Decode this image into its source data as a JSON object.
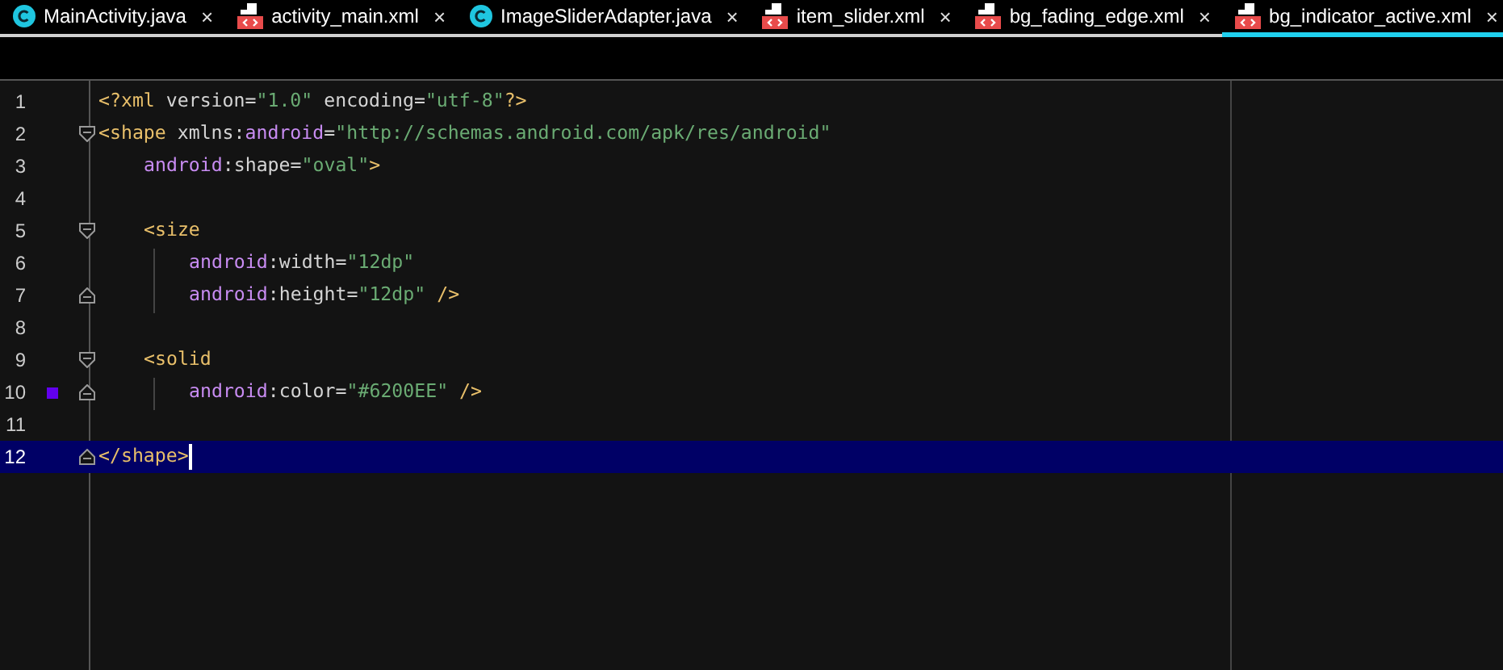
{
  "tabs": [
    {
      "label": "MainActivity.java",
      "kind": "class",
      "selected": false
    },
    {
      "label": "activity_main.xml",
      "kind": "xml",
      "selected": false
    },
    {
      "label": "ImageSliderAdapter.java",
      "kind": "class",
      "selected": false
    },
    {
      "label": "item_slider.xml",
      "kind": "xml",
      "selected": false
    },
    {
      "label": "bg_fading_edge.xml",
      "kind": "xml",
      "selected": false
    },
    {
      "label": "bg_indicator_active.xml",
      "kind": "xml",
      "selected": true
    }
  ],
  "close_glyph": "×",
  "lines": [
    {
      "number": "1",
      "tokens": [
        {
          "kind": "tag",
          "text": "<?xml"
        },
        {
          "kind": "plain",
          "text": " version="
        },
        {
          "kind": "str",
          "text": "\"1.0\""
        },
        {
          "kind": "plain",
          "text": " encoding="
        },
        {
          "kind": "str",
          "text": "\"utf-8\""
        },
        {
          "kind": "tag",
          "text": "?>"
        }
      ],
      "selected": false
    },
    {
      "number": "2",
      "fold": {
        "kind": "start"
      },
      "tokens": [
        {
          "kind": "tag",
          "text": "<shape"
        },
        {
          "kind": "plain",
          "text": " xmlns:"
        },
        {
          "kind": "ns",
          "text": "android"
        },
        {
          "kind": "plain",
          "text": "="
        },
        {
          "kind": "str",
          "text": "\"http://schemas.android.com/apk/res/android\""
        }
      ],
      "selected": false,
      "children": [
        {
          "number": "3",
          "tokens": [
            {
              "kind": "ns",
              "text": "android"
            },
            {
              "kind": "plain",
              "text": ":shape="
            },
            {
              "kind": "str",
              "text": "\"oval\""
            },
            {
              "kind": "tag",
              "text": ">"
            }
          ],
          "selected": false
        },
        {
          "number": "4",
          "selected": false
        },
        {
          "number": "5",
          "fold": {
            "kind": "start"
          },
          "tokens": [
            {
              "kind": "tag",
              "text": "<size"
            }
          ],
          "selected": false,
          "children": [
            {
              "number": "6",
              "tokens": [
                {
                  "kind": "ns",
                  "text": "android"
                },
                {
                  "kind": "plain",
                  "text": ":width="
                },
                {
                  "kind": "str",
                  "text": "\"12dp\""
                }
              ],
              "selected": false
            },
            {
              "number": "7",
              "fold": {
                "kind": "end"
              },
              "tokens": [
                {
                  "kind": "ns",
                  "text": "android"
                },
                {
                  "kind": "plain",
                  "text": ":height="
                },
                {
                  "kind": "str",
                  "text": "\"12dp\""
                },
                {
                  "kind": "tag",
                  "text": " />"
                }
              ],
              "selected": false
            }
          ]
        },
        {
          "number": "8",
          "selected": false
        },
        {
          "number": "9",
          "fold": {
            "kind": "start"
          },
          "tokens": [
            {
              "kind": "tag",
              "text": "<solid"
            }
          ],
          "selected": false,
          "children": [
            {
              "number": "10",
              "fold": {
                "kind": "end"
              },
              "color": "#6200ee",
              "tokens": [
                {
                  "kind": "ns",
                  "text": "android"
                },
                {
                  "kind": "plain",
                  "text": ":color="
                },
                {
                  "kind": "str",
                  "text": "\"#6200EE\""
                },
                {
                  "kind": "tag",
                  "text": " />"
                }
              ],
              "selected": false
            }
          ]
        },
        {
          "number": "11",
          "selected": false
        }
      ]
    },
    {
      "number": "12",
      "fold": {
        "kind": "end"
      },
      "tokens": [
        {
          "kind": "tag",
          "text": "</shape>"
        }
      ],
      "selected": true
    }
  ]
}
